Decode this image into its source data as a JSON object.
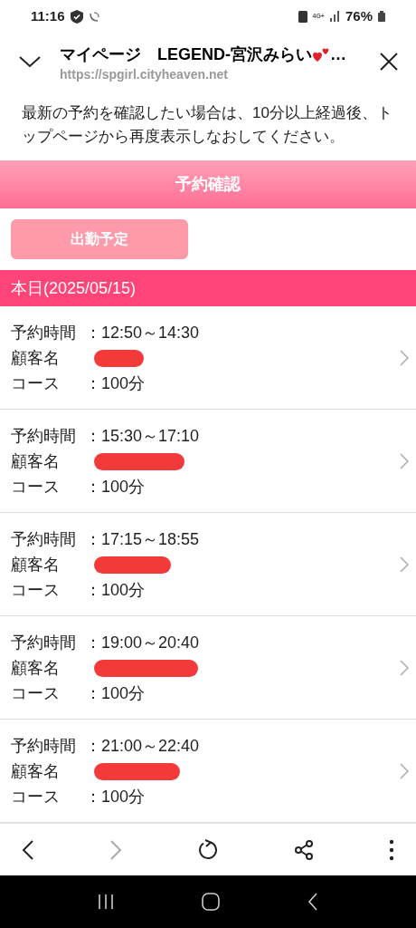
{
  "status_bar": {
    "time": "11:16",
    "network": "4G+",
    "battery": "76%"
  },
  "browser_header": {
    "title": "マイページ　LEGEND-宮沢みらい",
    "title_end": "…",
    "url": "https://spgirl.cityheaven.net"
  },
  "notice": "最新の予約を確認したい場合は、10分以上経過後、トップページから再度表示しなおしてください。",
  "section_title": "予約確認",
  "schedule_button": "出勤予定",
  "date_header": "本日(2025/05/15)",
  "reservations": [
    {
      "time_label": "予約時間",
      "time": "：12:50～14:30",
      "customer_label": "顧客名",
      "course_label": "コース",
      "course": "：100分"
    },
    {
      "time_label": "予約時間",
      "time": "：15:30～17:10",
      "customer_label": "顧客名",
      "course_label": "コース",
      "course": "：100分"
    },
    {
      "time_label": "予約時間",
      "time": "：17:15～18:55",
      "customer_label": "顧客名",
      "course_label": "コース",
      "course": "：100分"
    },
    {
      "time_label": "予約時間",
      "time": "：19:00～20:40",
      "customer_label": "顧客名",
      "course_label": "コース",
      "course": "：100分"
    },
    {
      "time_label": "予約時間",
      "time": "：21:00～22:40",
      "customer_label": "顧客名",
      "course_label": "コース",
      "course": "：100分"
    }
  ],
  "toolbar": {
    "back_disabled": false,
    "forward_disabled": true
  }
}
